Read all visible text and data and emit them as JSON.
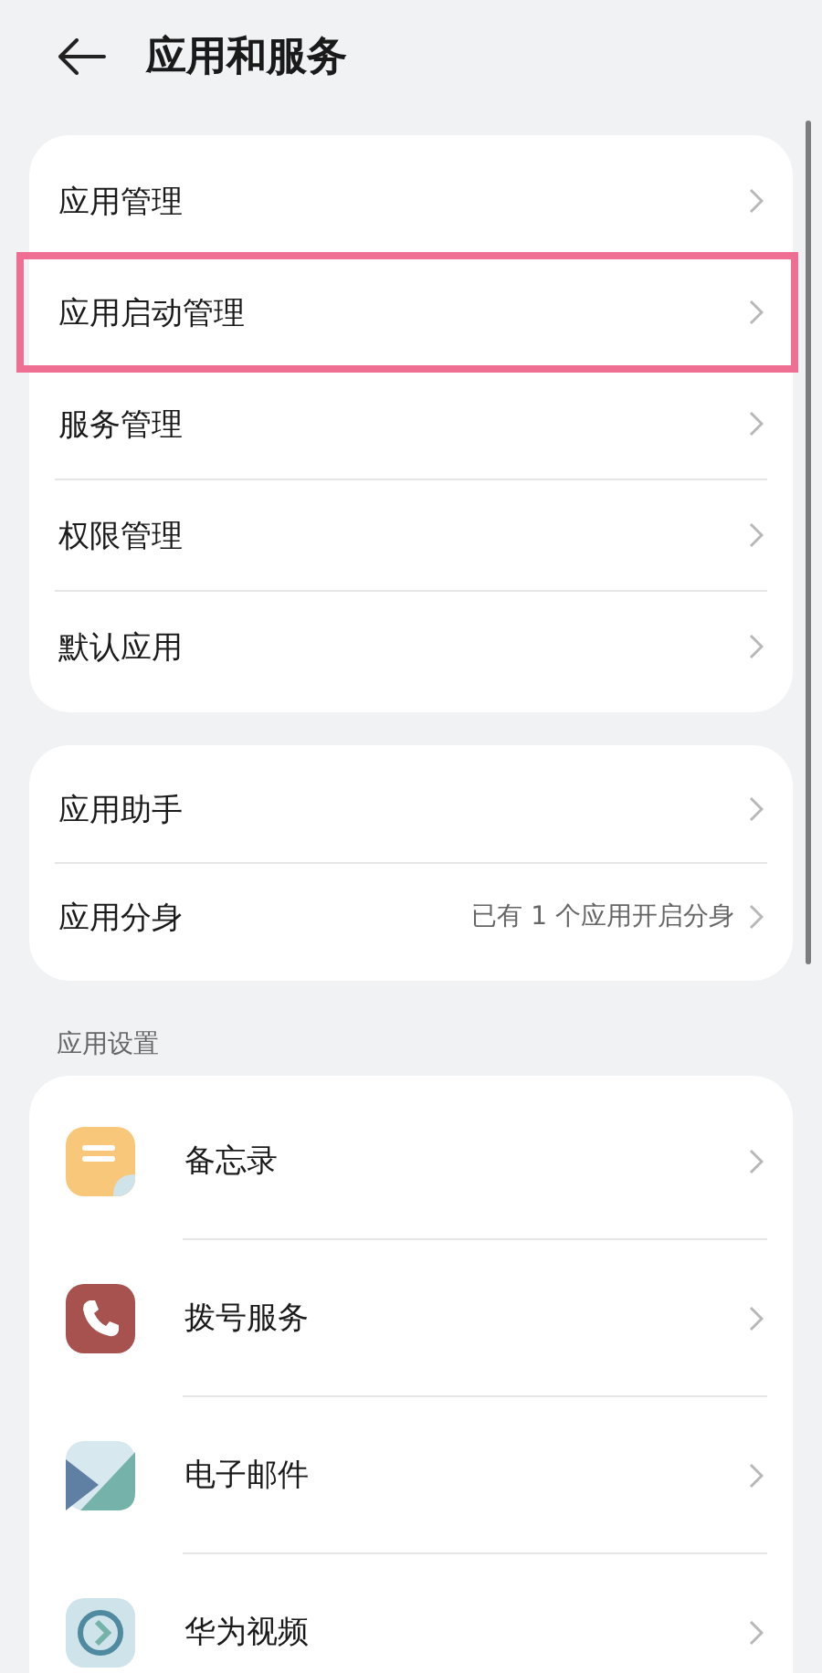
{
  "header": {
    "title": "应用和服务"
  },
  "groups": [
    {
      "items": [
        {
          "label": "应用管理",
          "highlighted": false
        },
        {
          "label": "应用启动管理",
          "highlighted": true
        },
        {
          "label": "服务管理",
          "highlighted": false
        },
        {
          "label": "权限管理",
          "highlighted": false
        },
        {
          "label": "默认应用",
          "highlighted": false
        }
      ]
    },
    {
      "items": [
        {
          "label": "应用助手",
          "highlighted": false
        },
        {
          "label": "应用分身",
          "value": "已有 1 个应用开启分身",
          "highlighted": false
        }
      ]
    }
  ],
  "app_settings": {
    "heading": "应用设置",
    "apps": [
      {
        "label": "备忘录",
        "kind": "notes"
      },
      {
        "label": "拨号服务",
        "kind": "phone"
      },
      {
        "label": "电子邮件",
        "kind": "mail"
      },
      {
        "label": "华为视频",
        "kind": "video"
      }
    ]
  }
}
